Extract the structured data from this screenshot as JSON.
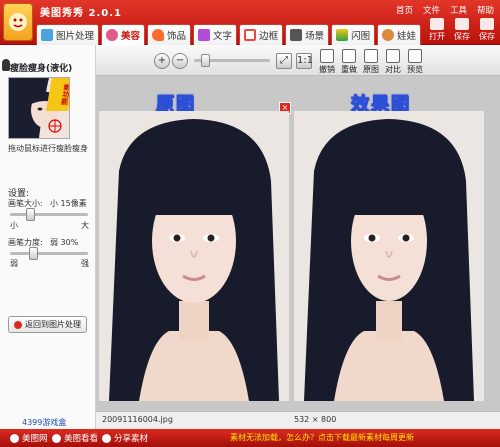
{
  "window": {
    "title": "美图秀秀 2.0.1"
  },
  "menu": [
    "首页",
    "文件",
    "工具",
    "帮助"
  ],
  "toolbar_right": [
    "打开",
    "保存",
    "保存"
  ],
  "tabs": [
    {
      "label": "图片处理",
      "icon": "photo-icon",
      "color": "#4aa3df"
    },
    {
      "label": "美容",
      "icon": "face-icon",
      "color": "#e25a88"
    },
    {
      "label": "饰品",
      "icon": "heart-icon",
      "color": "#ff6a2e"
    },
    {
      "label": "文字",
      "icon": "text-icon",
      "color": "#b44bd6"
    },
    {
      "label": "边框",
      "icon": "frame-icon",
      "color": "#e74c3c"
    },
    {
      "label": "场景",
      "icon": "scene-icon",
      "color": "#555555"
    },
    {
      "label": "闪图",
      "icon": "flash-icon",
      "color": "#2ea043"
    },
    {
      "label": "娃娃",
      "icon": "doll-icon",
      "color": "#d98a3c"
    }
  ],
  "active_tab": "美容",
  "left_panel": {
    "title": "瘦脸瘦身(液化)",
    "thumb_badge": "新功能",
    "hint": "拖动鼠标进行瘦脸瘦身",
    "settings_label": "设置:",
    "brush_size_label": "画笔大小:",
    "brush_size_value": "小 15像素",
    "brush_size_min": "小",
    "brush_size_max": "大",
    "brush_size_level": 0.25,
    "brush_power_label": "画笔力度:",
    "brush_power_value": "弱 30%",
    "brush_power_min": "弱",
    "brush_power_max": "强",
    "brush_power_level": 0.3,
    "back_button": "返回到图片处理",
    "games_link": "4399游戏盒"
  },
  "view_toolbar": {
    "zoom_in": "+",
    "zoom_out": "−",
    "zoom_level": 0.15,
    "tools": [
      "撤销",
      "重做",
      "原图",
      "对比",
      "预览"
    ]
  },
  "views": {
    "original_label": "原图",
    "effect_label": "效果图",
    "close": "×"
  },
  "status": {
    "filename": "20091116004.jpg",
    "dimensions": "532 × 800"
  },
  "bottom_bar": {
    "links": [
      "美图网",
      "美图看看",
      "分享素材"
    ],
    "notice": "素材无法加载，怎么办？点击下载最新素材每周更新"
  },
  "colors": {
    "brand_red": "#d42a1f",
    "label_blue": "#2d4fd6",
    "notice_yellow": "#ffe500"
  }
}
